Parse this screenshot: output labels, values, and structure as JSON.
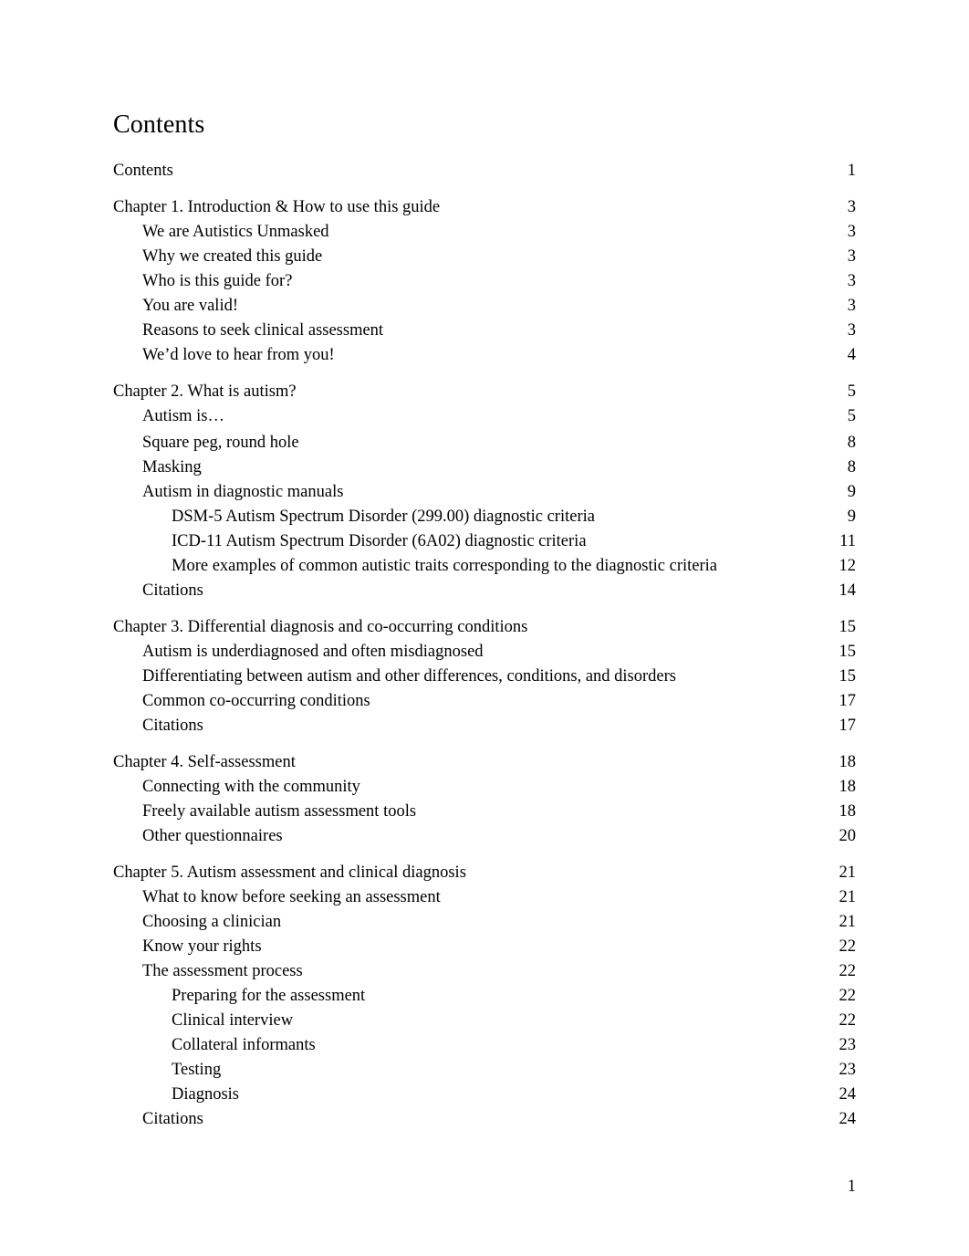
{
  "document": {
    "heading": "Contents",
    "footer_page_number": "1"
  },
  "toc": {
    "entries": [
      {
        "title": "Contents",
        "page": "1",
        "level": 1,
        "gap": "none"
      },
      {
        "title": "Chapter 1. Introduction & How to use this guide",
        "page": "3",
        "level": 1,
        "gap": "chapter"
      },
      {
        "title": "We are Autistics Unmasked",
        "page": "3",
        "level": 2,
        "gap": "none"
      },
      {
        "title": "Why we created this guide",
        "page": "3",
        "level": 2,
        "gap": "none"
      },
      {
        "title": "Who is this guide for?",
        "page": "3",
        "level": 2,
        "gap": "none"
      },
      {
        "title": "You are valid!",
        "page": "3",
        "level": 2,
        "gap": "none"
      },
      {
        "title": "Reasons to seek clinical assessment",
        "page": "3",
        "level": 2,
        "gap": "none"
      },
      {
        "title": "We’d love to hear from you!",
        "page": "4",
        "level": 2,
        "gap": "none"
      },
      {
        "title": "Chapter 2. What is autism?",
        "page": "5",
        "level": 1,
        "gap": "chapter"
      },
      {
        "title": "Autism is…",
        "page": "5",
        "level": 2,
        "gap": "none"
      },
      {
        "title": "Square peg, round hole",
        "page": "8",
        "level": 2,
        "gap": "small"
      },
      {
        "title": "Masking",
        "page": "8",
        "level": 2,
        "gap": "none"
      },
      {
        "title": "Autism in diagnostic manuals",
        "page": "9",
        "level": 2,
        "gap": "none"
      },
      {
        "title": "DSM-5 Autism Spectrum Disorder (299.00) diagnostic criteria",
        "page": "9",
        "level": 3,
        "gap": "none"
      },
      {
        "title": "ICD-11 Autism Spectrum Disorder (6A02) diagnostic criteria",
        "page": "11",
        "level": 3,
        "gap": "none"
      },
      {
        "title": "More examples of common autistic traits corresponding to the diagnostic criteria",
        "page": "12",
        "level": 3,
        "gap": "none"
      },
      {
        "title": "Citations",
        "page": "14",
        "level": 2,
        "gap": "none"
      },
      {
        "title": "Chapter 3. Differential diagnosis and co-occurring conditions",
        "page": "15",
        "level": 1,
        "gap": "chapter"
      },
      {
        "title": "Autism is underdiagnosed and often misdiagnosed",
        "page": "15",
        "level": 2,
        "gap": "none"
      },
      {
        "title": "Differentiating between autism and other differences, conditions, and disorders",
        "page": "15",
        "level": 2,
        "gap": "none"
      },
      {
        "title": "Common co-occurring conditions",
        "page": "17",
        "level": 2,
        "gap": "none"
      },
      {
        "title": "Citations",
        "page": "17",
        "level": 2,
        "gap": "none"
      },
      {
        "title": "Chapter 4. Self-assessment",
        "page": "18",
        "level": 1,
        "gap": "chapter"
      },
      {
        "title": "Connecting with the community",
        "page": "18",
        "level": 2,
        "gap": "none"
      },
      {
        "title": "Freely available autism assessment tools",
        "page": "18",
        "level": 2,
        "gap": "none"
      },
      {
        "title": "Other questionnaires",
        "page": "20",
        "level": 2,
        "gap": "none"
      },
      {
        "title": "Chapter 5. Autism assessment and clinical diagnosis",
        "page": "21",
        "level": 1,
        "gap": "chapter"
      },
      {
        "title": "What to know before seeking an assessment",
        "page": "21",
        "level": 2,
        "gap": "none"
      },
      {
        "title": "Choosing a clinician",
        "page": "21",
        "level": 2,
        "gap": "none"
      },
      {
        "title": "Know your rights",
        "page": "22",
        "level": 2,
        "gap": "none"
      },
      {
        "title": "The assessment process",
        "page": "22",
        "level": 2,
        "gap": "none"
      },
      {
        "title": "Preparing for the assessment",
        "page": "22",
        "level": 3,
        "gap": "none"
      },
      {
        "title": "Clinical interview",
        "page": "22",
        "level": 3,
        "gap": "none"
      },
      {
        "title": "Collateral informants",
        "page": "23",
        "level": 3,
        "gap": "none"
      },
      {
        "title": "Testing",
        "page": "23",
        "level": 3,
        "gap": "none"
      },
      {
        "title": "Diagnosis",
        "page": "24",
        "level": 3,
        "gap": "none"
      },
      {
        "title": "Citations",
        "page": "24",
        "level": 2,
        "gap": "none"
      }
    ]
  }
}
